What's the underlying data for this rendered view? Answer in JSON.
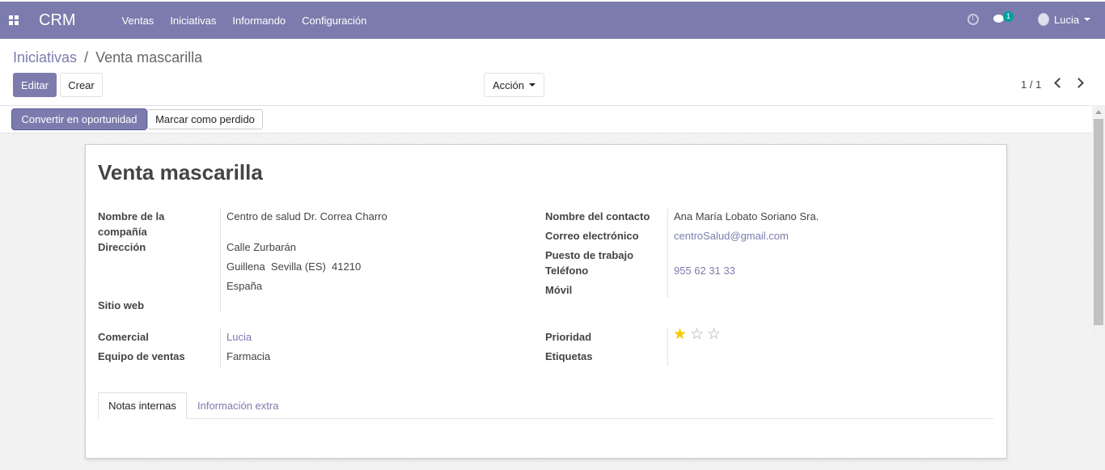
{
  "navbar": {
    "brand": "CRM",
    "menu": [
      "Ventas",
      "Iniciativas",
      "Informando",
      "Configuración"
    ],
    "messages_count": "1",
    "user_name": "Lucia"
  },
  "breadcrumb": {
    "parent": "Iniciativas",
    "separator": "/",
    "current": "Venta mascarilla"
  },
  "toolbar": {
    "edit_label": "Editar",
    "create_label": "Crear",
    "action_label": "Acción",
    "pager": "1 / 1"
  },
  "statusbar": {
    "convert_label": "Convertir en oportunidad",
    "lost_label": "Marcar como perdido"
  },
  "record": {
    "title": "Venta mascarilla",
    "fields": {
      "company_label_1": "Nombre de la",
      "company_label_2": "compañía",
      "company": "Centro de salud Dr. Correa Charro",
      "address_label": "Dirección",
      "street": "Calle Zurbarán",
      "city_line": "Guillena  Sevilla (ES)  41210",
      "country": "España",
      "website_label": "Sitio web",
      "contact_label": "Nombre del contacto",
      "contact": "Ana María Lobato Soriano Sra.",
      "email_label": "Correo electrónico",
      "email": "centroSalud@gmail.com",
      "job_label": "Puesto de trabajo",
      "phone_label": "Teléfono",
      "phone": "955 62 31 33",
      "mobile_label": "Móvil",
      "salesperson_label": "Comercial",
      "salesperson": "Lucia",
      "team_label": "Equipo de ventas",
      "team": "Farmacia",
      "priority_label": "Prioridad",
      "priority": 1,
      "priority_max": 3,
      "tags_label": "Etiquetas"
    },
    "tabs": [
      "Notas internas",
      "Información extra"
    ]
  }
}
